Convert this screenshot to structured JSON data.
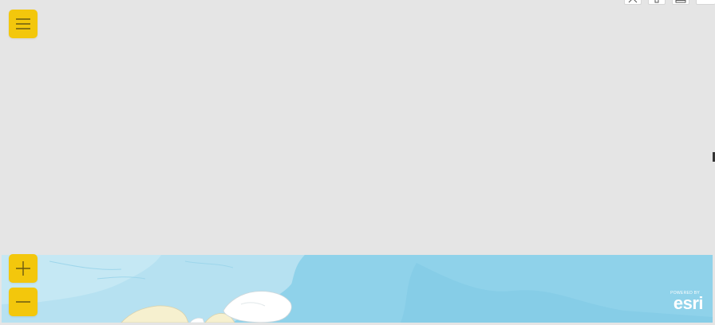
{
  "toolbar": {
    "menu_icon": "hamburger-menu-icon",
    "top_tools": [
      "select-icon",
      "pin-icon",
      "table-icon",
      "more-icon"
    ]
  },
  "zoom": {
    "in_icon": "plus-icon",
    "out_icon": "minus-icon"
  },
  "map": {
    "basemap": "ocean",
    "attribution": {
      "powered_by": "POWERED BY",
      "brand": "esri"
    }
  },
  "colors": {
    "accent": "#f3c70c",
    "background": "#e5e5e5",
    "water_deep": "#8fd2ea",
    "water_shallow": "#b6e1f1",
    "land": "#f6f0cf",
    "ice": "#ffffff"
  }
}
